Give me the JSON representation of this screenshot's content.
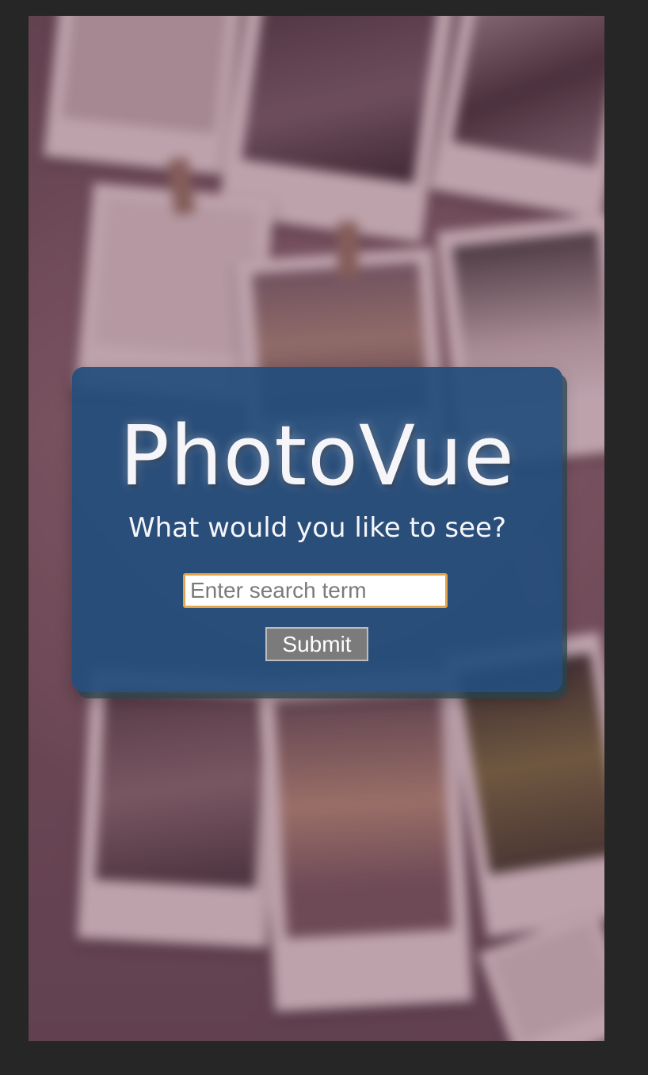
{
  "app": {
    "title": "PhotoVue",
    "subtitle": "What would you like to see?"
  },
  "search": {
    "placeholder": "Enter search term",
    "value": ""
  },
  "form": {
    "submit_label": "Submit"
  },
  "colors": {
    "card_background": "#244d7c",
    "input_focus_border": "#e3a548",
    "button_background": "#7b7b7b",
    "page_background": "#262626"
  }
}
